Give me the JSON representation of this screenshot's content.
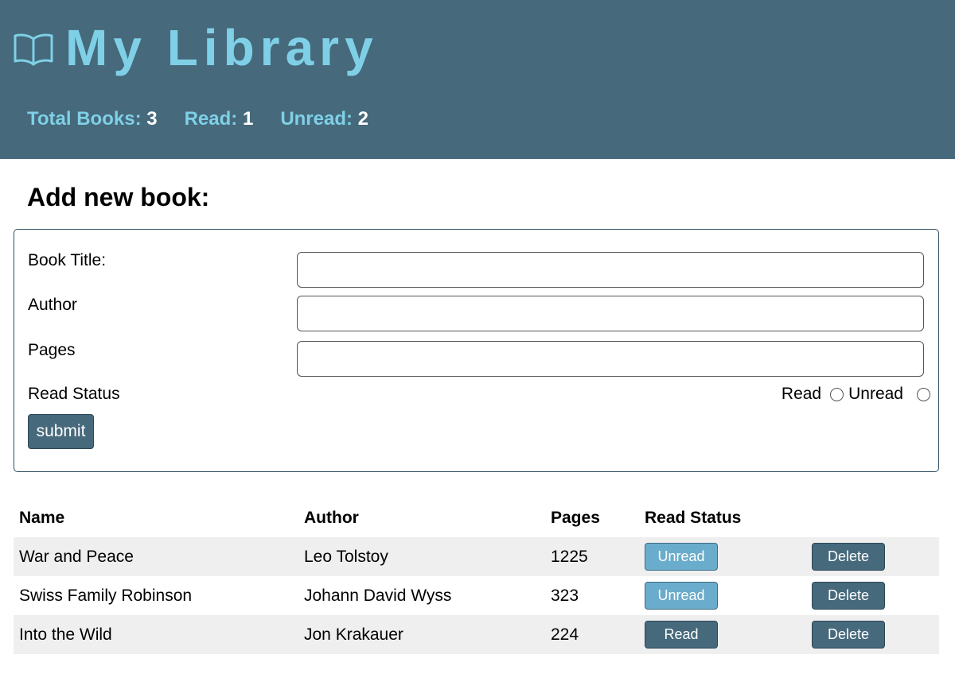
{
  "app": {
    "title": "My Library"
  },
  "stats": {
    "total_label": "Total Books:",
    "total_value": "3",
    "read_label": "Read:",
    "read_value": "1",
    "unread_label": "Unread:",
    "unread_value": "2"
  },
  "form": {
    "heading": "Add new book:",
    "title_label": "Book Title:",
    "title_value": "",
    "author_label": "Author",
    "author_value": "",
    "pages_label": "Pages",
    "pages_value": "",
    "status_label": "Read Status",
    "read_option": "Read",
    "unread_option": "Unread",
    "submit_label": "submit"
  },
  "table": {
    "headers": {
      "name": "Name",
      "author": "Author",
      "pages": "Pages",
      "status": "Read Status"
    },
    "rows": [
      {
        "name": "War and Peace",
        "author": "Leo Tolstoy",
        "pages": "1225",
        "status": "Unread",
        "delete": "Delete"
      },
      {
        "name": "Swiss Family Robinson",
        "author": "Johann David Wyss",
        "pages": "323",
        "status": "Unread",
        "delete": "Delete"
      },
      {
        "name": "Into the Wild",
        "author": "Jon Krakauer",
        "pages": "224",
        "status": "Read",
        "delete": "Delete"
      }
    ]
  },
  "colors": {
    "header_bg": "#46697c",
    "accent": "#7fd0e6",
    "unread_button": "#6aaccb",
    "read_button": "#46697c"
  },
  "icons": {
    "logo": "open-book-icon"
  }
}
